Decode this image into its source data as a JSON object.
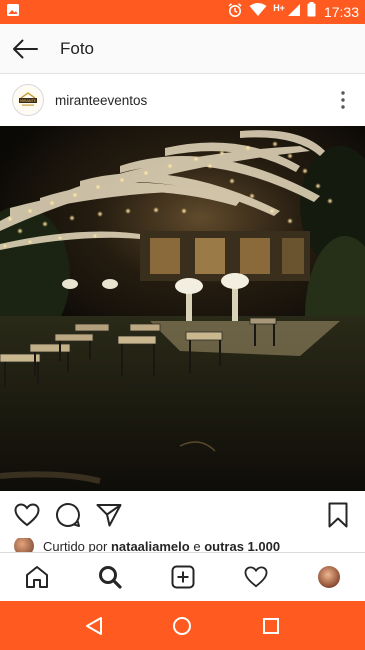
{
  "status_bar": {
    "time": "17:33",
    "network": "H+",
    "bg_color": "#ff5a1f",
    "icons": [
      "image-icon",
      "alarm-icon",
      "wifi-icon",
      "signal-icon",
      "battery-icon"
    ]
  },
  "app_bar": {
    "title": "Foto",
    "back_icon": "arrow-left-icon"
  },
  "post": {
    "username": "miranteeventos",
    "avatar_text": "MIRANTE",
    "more_icon": "more-vertical-icon",
    "photo_alt": "night wedding ceremony with string lights"
  },
  "actions": {
    "icons": [
      "heart-icon",
      "comment-icon",
      "share-icon",
      "bookmark-icon"
    ]
  },
  "likes": {
    "prefix": "Curtido por",
    "user": "nataaliamelo",
    "connector": "e",
    "others": "outras 1.000"
  },
  "bottom_nav": {
    "items": [
      "home-icon",
      "search-icon",
      "add-icon",
      "heart-icon",
      "profile-icon"
    ]
  },
  "system_nav": {
    "items": [
      "back-triangle-icon",
      "home-circle-icon",
      "recents-square-icon"
    ],
    "bg_color": "#ff5a1f"
  }
}
